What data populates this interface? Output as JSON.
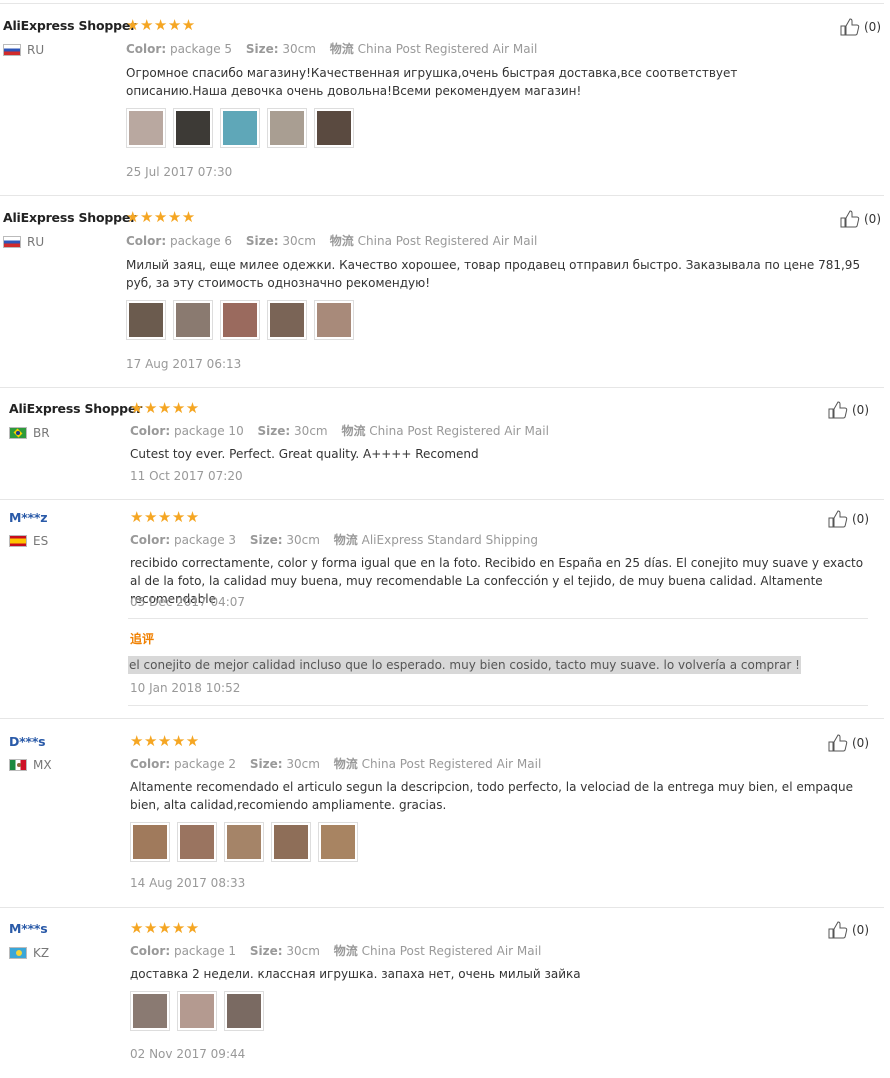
{
  "labels": {
    "color": "Color:",
    "size": "Size:",
    "logistics": "物流",
    "followup": "追评"
  },
  "colors": {
    "star": "#f5a623",
    "followup_title": "#f08000",
    "masked_user": "#2a5aa8"
  },
  "reviews": [
    {
      "user": "AliExpress Shopper",
      "country": "RU",
      "flag": "flag-ru",
      "rating": 5,
      "stars": "★★★★★",
      "color": "package 5",
      "size": "30cm",
      "shipping": "China Post Registered Air Mail",
      "text": "Огромное спасибо магазину!Качественная игрушка,очень быстрая доставка,все соответствует описанию.Наша девочка очень довольна!Всеми рекомендуем магазин!",
      "photos": [
        "#b9a8a0",
        "#3d3a36",
        "#5fa7b8",
        "#a99e92",
        "#5a4a40"
      ],
      "date": "25 Jul 2017 07:30",
      "helpful": "(0)"
    },
    {
      "user": "AliExpress Shopper",
      "country": "RU",
      "flag": "flag-ru",
      "rating": 5,
      "stars": "★★★★★",
      "color": "package 6",
      "size": "30cm",
      "shipping": "China Post Registered Air Mail",
      "text": "Милый заяц, еще милее одежки. Качество хорошее, товар продавец отправил быстро. Заказывала по цене 781,95 руб, за эту стоимость однозначно рекомендую!",
      "photos": [
        "#6b5b4e",
        "#8a7a70",
        "#9a6a5e",
        "#7a6456",
        "#a88a7a"
      ],
      "date": "17 Aug 2017 06:13",
      "helpful": "(0)"
    },
    {
      "user": "AliExpress Shopper",
      "country": "BR",
      "flag": "flag-br",
      "rating": 5,
      "stars": "★★★★★",
      "color": "package 10",
      "size": "30cm",
      "shipping": "China Post Registered Air Mail",
      "text": "Cutest toy ever. Perfect. Great quality. A++++ Recomend",
      "photos": [],
      "date": "11 Oct 2017 07:20",
      "helpful": "(0)"
    },
    {
      "user": "M***z",
      "country": "ES",
      "flag": "flag-es",
      "rating": 5,
      "stars": "★★★★★",
      "color": "package 3",
      "size": "30cm",
      "shipping": "AliExpress Standard Shipping",
      "text": "recibido correctamente, color y forma igual que en la foto. Recibido en España en 25 días. El conejito muy suave y exacto al de la foto, la calidad muy buena, muy recomendable La confección y el tejido, de muy buena calidad. Altamente recomendable",
      "photos": [],
      "date": "05 Dec 2017 04:07",
      "followup_text": "el conejito de mejor calidad incluso que lo esperado. muy bien cosido, tacto muy suave. lo volvería a comprar !",
      "followup_date": "10 Jan 2018 10:52",
      "helpful": "(0)"
    },
    {
      "user": "D***s",
      "country": "MX",
      "flag": "flag-mx",
      "rating": 5,
      "stars": "★★★★★",
      "color": "package 2",
      "size": "30cm",
      "shipping": "China Post Registered Air Mail",
      "text": "Altamente recomendado el articulo segun la descripcion, todo perfecto, la velociad de la entrega muy bien, el empaque bien, alta calidad,recomiendo ampliamente. gracias.",
      "photos": [
        "#a07a5c",
        "#9a7460",
        "#a58468",
        "#8e6e58",
        "#a88462"
      ],
      "date": "14 Aug 2017 08:33",
      "helpful": "(0)"
    },
    {
      "user": "M***s",
      "country": "KZ",
      "flag": "flag-kz",
      "rating": 5,
      "stars": "★★★★★",
      "color": "package 1",
      "size": "30cm",
      "shipping": "China Post Registered Air Mail",
      "text": "доставка 2 недели. классная игрушка. запаха нет, очень милый зайка",
      "photos": [
        "#8a7a72",
        "#b49a90",
        "#7a6a62"
      ],
      "date": "02 Nov 2017 09:44",
      "helpful": "(0)"
    }
  ]
}
